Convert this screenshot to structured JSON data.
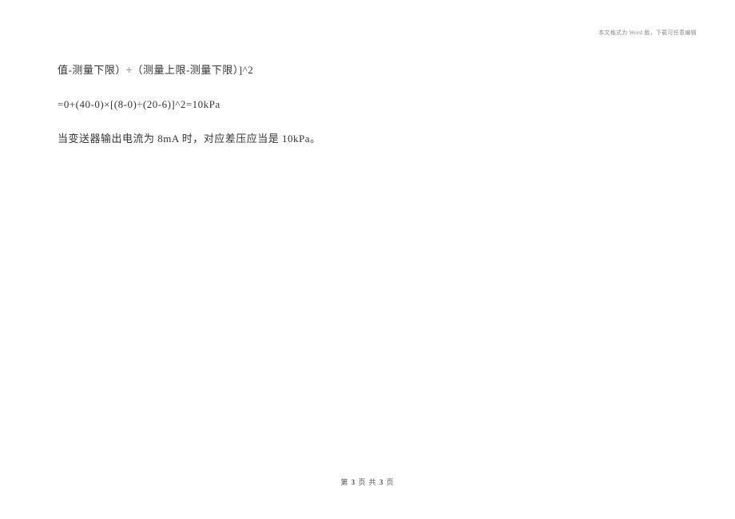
{
  "header": {
    "note": "本文格式为 Word 版，下载可任意编辑"
  },
  "content": {
    "line1": "值-测量下限）÷（测量上限-测量下限）]^2",
    "line2": "=0+(40-0)×[(8-0)÷(20-6)]^2=10kPa",
    "line3": "当变送器输出电流为 8mA 时，对应差压应当是 10kPa。"
  },
  "footer": {
    "prefix": "第 ",
    "current": "3",
    "mid": " 页 共 ",
    "total": "3",
    "suffix": " 页"
  }
}
